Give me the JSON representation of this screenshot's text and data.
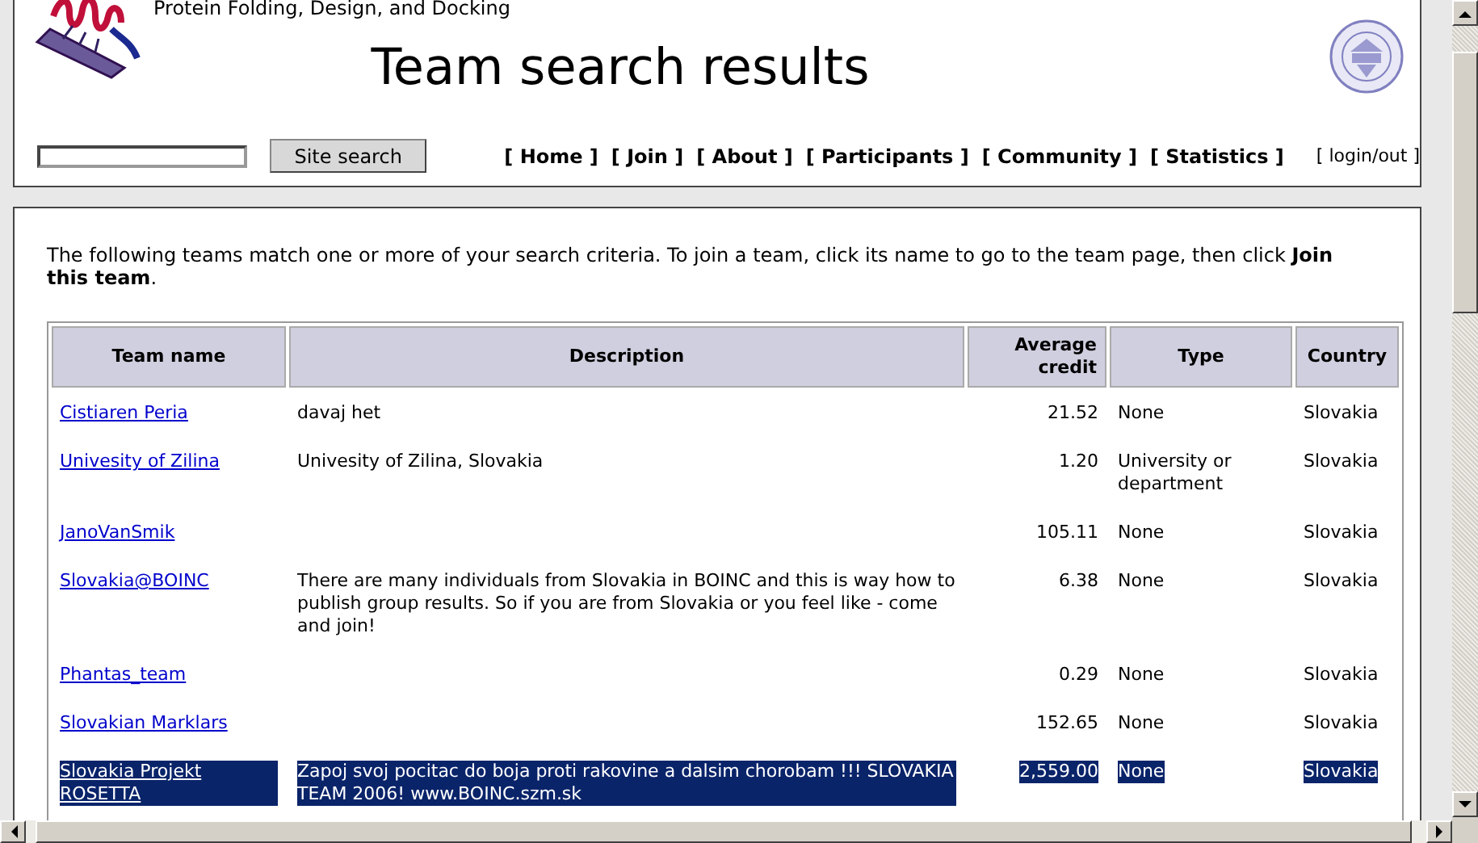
{
  "header": {
    "tagline": "Protein Folding, Design, and Docking",
    "title": "Team search results",
    "search": {
      "button": "Site search"
    },
    "nav": [
      "[ Home ]",
      "[ Join ]",
      "[ About ]",
      "[ Participants ]",
      "[ Community ]",
      "[ Statistics ]"
    ],
    "login": "[ login/out ]"
  },
  "intro": "The following teams match one or more of your search criteria. To join a team, click its name to go to the team page, then click **Join this team**.",
  "table": {
    "columns": [
      "Team name",
      "Description",
      "Average credit",
      "Type",
      "Country"
    ],
    "rows": [
      {
        "name": "Cistiaren Peria",
        "description": "davaj het",
        "credit": "21.52",
        "type": "None",
        "country": "Slovakia",
        "selected": false
      },
      {
        "name": "Univesity of Zilina",
        "description": "Univesity of Zilina, Slovakia",
        "credit": "1.20",
        "type": "University or department",
        "country": "Slovakia",
        "selected": false
      },
      {
        "name": "JanoVanSmik",
        "description": "",
        "credit": "105.11",
        "type": "None",
        "country": "Slovakia",
        "selected": false
      },
      {
        "name": "Slovakia@BOINC",
        "description": "There are many individuals from Slovakia in BOINC and this is way how to publish group results. So if you are from Slovakia or you feel like - come and join!",
        "credit": "6.38",
        "type": "None",
        "country": "Slovakia",
        "selected": false
      },
      {
        "name": "Phantas_team",
        "description": "",
        "credit": "0.29",
        "type": "None",
        "country": "Slovakia",
        "selected": false
      },
      {
        "name": "Slovakian Marklars",
        "description": "",
        "credit": "152.65",
        "type": "None",
        "country": "Slovakia",
        "selected": false
      },
      {
        "name": "Slovakia Projekt ROSETTA",
        "description": "Zapoj svoj pocitac do boja proti rakovine a dalsim chorobam !!! SLOVAKIA TEAM 2006! www.BOINC.szm.sk",
        "credit": "2,559.00",
        "type": "None",
        "country": "Slovakia",
        "selected": true
      }
    ]
  }
}
